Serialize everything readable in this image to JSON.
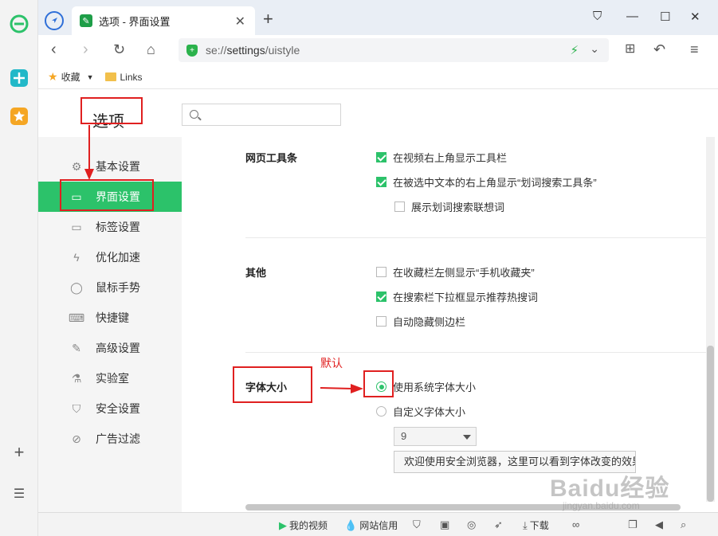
{
  "tab": {
    "title": "选项 - 界面设置",
    "close": "✕",
    "new_tab": "+"
  },
  "window": {
    "shirt": "⛉",
    "minimize": "—",
    "maximize": "☐",
    "close": "✕"
  },
  "address": {
    "scheme": "se://",
    "host": "settings",
    "path": "/uistyle"
  },
  "bookmarks": {
    "favorites": "收藏",
    "links": "Links"
  },
  "settings": {
    "title": "选项",
    "search_placeholder": ""
  },
  "sidebar": {
    "items": [
      {
        "label": "基本设置",
        "icon": "gear-icon"
      },
      {
        "label": "界面设置",
        "icon": "window-icon",
        "active": true
      },
      {
        "label": "标签设置",
        "icon": "tab-icon"
      },
      {
        "label": "优化加速",
        "icon": "bolt-icon"
      },
      {
        "label": "鼠标手势",
        "icon": "mouse-icon"
      },
      {
        "label": "快捷键",
        "icon": "keyboard-icon"
      },
      {
        "label": "高级设置",
        "icon": "wrench-icon"
      },
      {
        "label": "实验室",
        "icon": "flask-icon"
      },
      {
        "label": "安全设置",
        "icon": "shield-icon"
      },
      {
        "label": "广告过滤",
        "icon": "block-icon"
      }
    ]
  },
  "sections": {
    "webtoolbar": {
      "title": "网页工具条",
      "options": [
        {
          "label": "在视频右上角显示工具栏",
          "checked": true
        },
        {
          "label": "在被选中文本的右上角显示“划词搜索工具条”",
          "checked": true
        },
        {
          "label": "展示划词搜索联想词",
          "checked": false
        }
      ]
    },
    "other": {
      "title": "其他",
      "options": [
        {
          "label": "在收藏栏左侧显示“手机收藏夹”",
          "checked": false
        },
        {
          "label": "在搜索栏下拉框显示推荐热搜词",
          "checked": true
        },
        {
          "label": "自动隐藏侧边栏",
          "checked": false
        }
      ]
    },
    "fontsize": {
      "title": "字体大小",
      "system_label": "使用系统字体大小",
      "custom_label": "自定义字体大小",
      "size_value": "9",
      "preview_text": "欢迎使用安全浏览器，这里可以看到字体改变的效果"
    }
  },
  "annotation": {
    "default_label": "默认"
  },
  "statusbar": {
    "my_video": "我的视频",
    "site_trust": "网站信用",
    "download": "下载"
  },
  "watermark": {
    "brand": "Baidu经验",
    "url": "jingyan.baidu.com"
  },
  "colors": {
    "accent": "#2cc26a",
    "annotation": "#e02020"
  }
}
